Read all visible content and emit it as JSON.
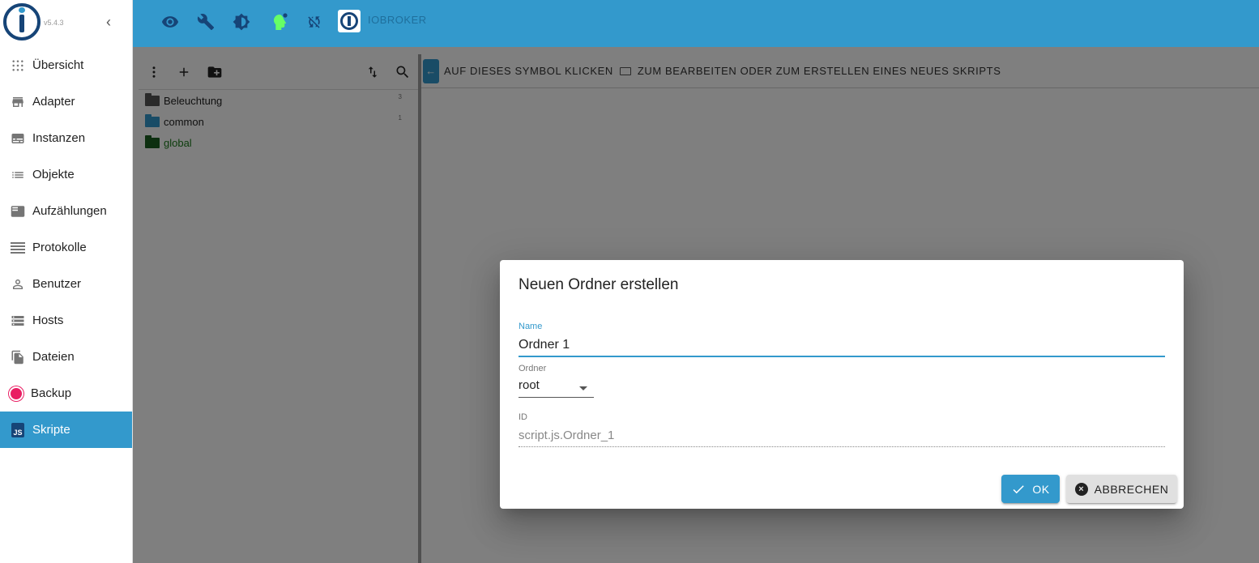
{
  "sidebar": {
    "version": "v5.4.3",
    "items": [
      {
        "label": "Übersicht",
        "icon": "grid-icon"
      },
      {
        "label": "Adapter",
        "icon": "store-icon"
      },
      {
        "label": "Instanzen",
        "icon": "subtitles-icon"
      },
      {
        "label": "Objekte",
        "icon": "list-icon"
      },
      {
        "label": "Aufzählungen",
        "icon": "featured-play-list-icon"
      },
      {
        "label": "Protokolle",
        "icon": "lines-icon"
      },
      {
        "label": "Benutzer",
        "icon": "person-icon"
      },
      {
        "label": "Hosts",
        "icon": "storage-icon"
      },
      {
        "label": "Dateien",
        "icon": "files-icon"
      },
      {
        "label": "Backup",
        "icon": "backup-clock-icon"
      },
      {
        "label": "Skripte",
        "icon": "js-icon",
        "active": true
      }
    ]
  },
  "topbar": {
    "brand": "IOBROKER",
    "icons": [
      "eye-icon",
      "wrench-icon",
      "brightness-icon",
      "expert-head-icon",
      "sync-off-icon"
    ]
  },
  "scripts_panel": {
    "tree": [
      {
        "label": "Beleuchtung",
        "count": "3",
        "color": "#555555"
      },
      {
        "label": "common",
        "count": "1",
        "color": "#3399cc"
      },
      {
        "label": "global",
        "count": "",
        "color": "#1b5e20"
      }
    ],
    "hint_left": "AUF DIESES SYMBOL KLICKEN",
    "hint_right": "ZUM BEARBEITEN ODER ZUM ERSTELLEN EINES NEUES SKRIPTS"
  },
  "dialog": {
    "title": "Neuen Ordner erstellen",
    "name_label": "Name",
    "name_value": "Ordner 1",
    "folder_label": "Ordner",
    "folder_value": "root",
    "id_label": "ID",
    "id_value": "script.js.Ordner_1",
    "ok_label": "OK",
    "cancel_label": "ABBRECHEN"
  },
  "colors": {
    "primary": "#3399cc",
    "dark_blue": "#164477",
    "expert_green": "#66ff66"
  }
}
